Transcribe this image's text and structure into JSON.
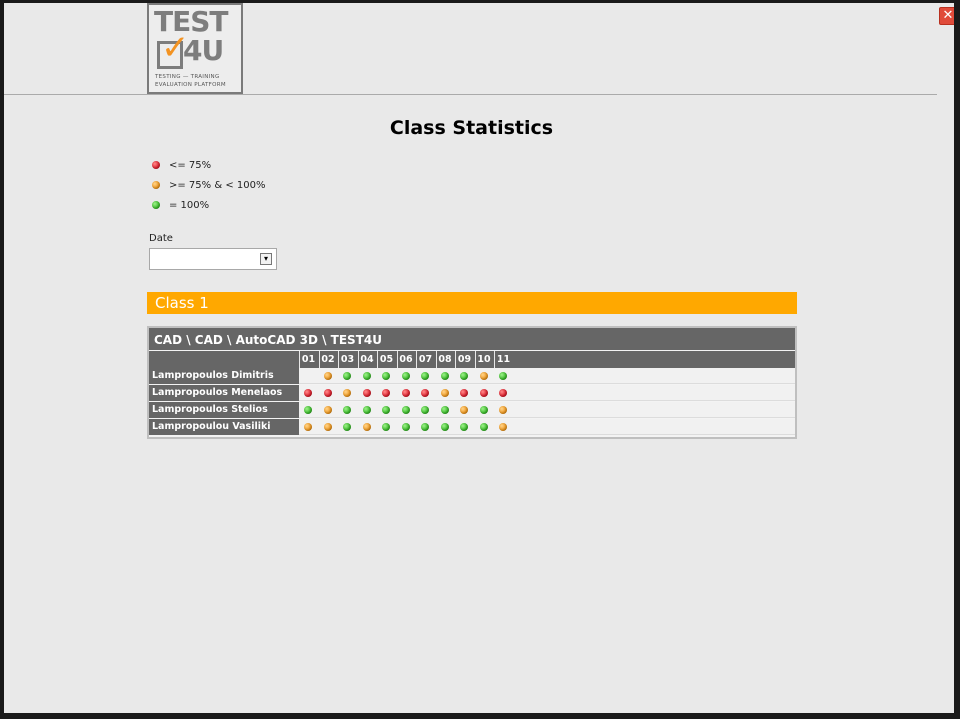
{
  "window": {
    "close_label": "✕"
  },
  "logo": {
    "brand_line1": "TEST",
    "brand_line2": "4U",
    "check_glyph": "✓",
    "tagline_line1": "TESTING — TRAINING",
    "tagline_line2": "EVALUATION PLATFORM"
  },
  "page_title": "Class Statistics",
  "legend": {
    "items": [
      {
        "color": "red",
        "label": "<= 75%"
      },
      {
        "color": "orange",
        "label": ">= 75% & < 100%"
      },
      {
        "color": "green",
        "label": "= 100%"
      }
    ]
  },
  "date_filter": {
    "label": "Date",
    "value": "",
    "arrow_glyph": "▾"
  },
  "class_bar": {
    "title": "Class 1"
  },
  "stats_table": {
    "course_path": "CAD \\ CAD \\ AutoCAD 3D \\ TEST4U",
    "columns": [
      "01",
      "02",
      "03",
      "04",
      "05",
      "06",
      "07",
      "08",
      "09",
      "10",
      "11"
    ],
    "rows": [
      {
        "name": "Lampropoulos Dimitris",
        "status": [
          "",
          "orange",
          "green",
          "green",
          "green",
          "green",
          "green",
          "green",
          "green",
          "orange",
          "green"
        ]
      },
      {
        "name": "Lampropoulos Menelaos",
        "status": [
          "red",
          "red",
          "orange",
          "red",
          "red",
          "red",
          "red",
          "orange",
          "red",
          "red",
          "red"
        ]
      },
      {
        "name": "Lampropoulos Stelios",
        "status": [
          "green",
          "orange",
          "green",
          "green",
          "green",
          "green",
          "green",
          "green",
          "orange",
          "green",
          "orange"
        ]
      },
      {
        "name": "Lampropoulou Vasiliki",
        "status": [
          "orange",
          "orange",
          "green",
          "orange",
          "green",
          "green",
          "green",
          "green",
          "green",
          "green",
          "orange"
        ]
      }
    ]
  },
  "colors": {
    "accent_bar": "#ffa800",
    "table_header": "#666666",
    "red": "#e0202e",
    "orange": "#f29a20",
    "green": "#3cbf2c"
  }
}
